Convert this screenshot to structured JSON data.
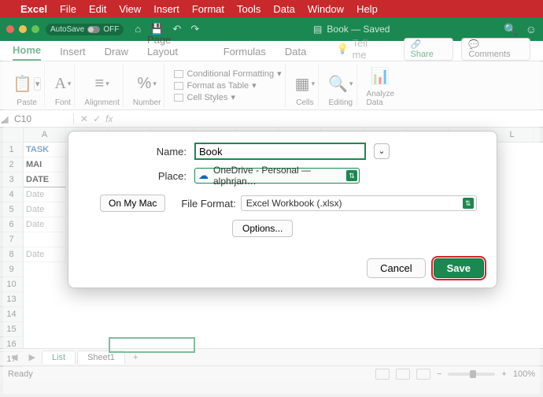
{
  "mac_menubar": {
    "items": [
      "Excel",
      "File",
      "Edit",
      "View",
      "Insert",
      "Format",
      "Tools",
      "Data",
      "Window",
      "Help"
    ]
  },
  "titlebar": {
    "autosave": "AutoSave",
    "off": "OFF",
    "doc": "Book — Saved"
  },
  "ribbon_tabs": {
    "tabs": [
      "Home",
      "Insert",
      "Draw",
      "Page Layout",
      "Formulas",
      "Data"
    ],
    "tell_me": "Tell me",
    "share": "Share",
    "comments": "Comments"
  },
  "ribbon": {
    "paste": "Paste",
    "font": "Font",
    "alignment": "Alignment",
    "number": "Number",
    "cf": "Conditional Formatting",
    "fat": "Format as Table",
    "cs": "Cell Styles",
    "cells": "Cells",
    "editing": "Editing",
    "analyze": "Analyze",
    "data": "Data"
  },
  "namebox": {
    "cell": "C10",
    "fx": "fx"
  },
  "sheet": {
    "a1": "TASK",
    "a2": "MAI",
    "a3": "DATE",
    "dates": [
      "Date",
      "Date",
      "Date",
      "Date"
    ]
  },
  "sheet_tabs": {
    "list": "List",
    "sheet1": "Sheet1",
    "plus": "+"
  },
  "statusbar": {
    "ready": "Ready",
    "zoom": "100%",
    "minus": "−",
    "plus": "+"
  },
  "dialog": {
    "name_label": "Name:",
    "name_value": "Book",
    "place_label": "Place:",
    "place_value": "OneDrive - Personal — alphrjan…",
    "on_my_mac": "On My Mac",
    "ff_label": "File Format:",
    "ff_value": "Excel Workbook (.xlsx)",
    "options": "Options...",
    "cancel": "Cancel",
    "save": "Save"
  }
}
